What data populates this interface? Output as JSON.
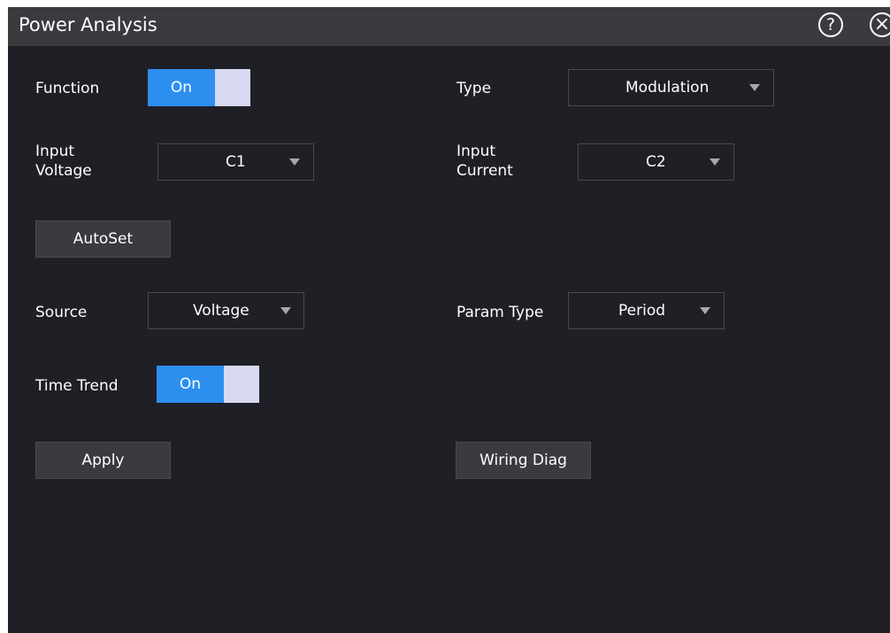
{
  "window": {
    "title": "Power Analysis"
  },
  "titlebar": {
    "help_glyph": "?",
    "close_glyph": "×",
    "help_icon": "question-circle-icon",
    "close_icon": "close-circle-icon"
  },
  "form": {
    "function": {
      "label": "Function",
      "state": "On"
    },
    "type": {
      "label": "Type",
      "value": "Modulation"
    },
    "input_voltage": {
      "label_line1": "Input",
      "label_line2": "Voltage",
      "value": "C1"
    },
    "input_current": {
      "label_line1": "Input",
      "label_line2": "Current",
      "value": "C2"
    },
    "autoset": {
      "label": "AutoSet"
    },
    "source": {
      "label": "Source",
      "value": "Voltage"
    },
    "param_type": {
      "label": "Param Type",
      "value": "Period"
    },
    "time_trend": {
      "label": "Time Trend",
      "state": "On"
    },
    "apply": {
      "label": "Apply"
    },
    "wiring_diag": {
      "label": "Wiring Diag"
    }
  },
  "colors": {
    "background": "#1f1f26",
    "titlebar": "#3a3a3f",
    "accent": "#2c8ff0",
    "toggle_knob": "#d7d9f0"
  }
}
